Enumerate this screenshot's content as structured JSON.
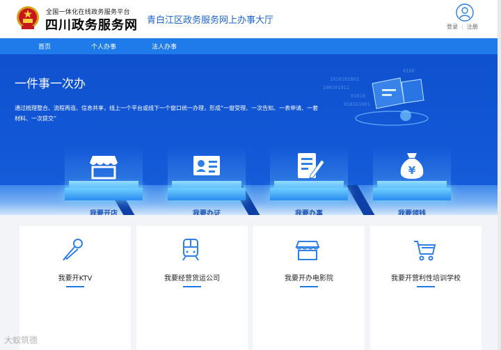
{
  "header": {
    "portal_subtitle": "全国一体化在线政务服务平台",
    "portal_name": "四川政务服务网",
    "hall_title": "青白江区政务服务网上办事大厅",
    "login_label": "登录",
    "register_label": "注册"
  },
  "nav": {
    "items": [
      {
        "label": "首页"
      },
      {
        "label": "个人办事"
      },
      {
        "label": "法人办事"
      }
    ]
  },
  "banner": {
    "title": "一件事一次办",
    "description": "通过梳理整合、流程再造、信息共享，线上一个平台或线下一个窗口统一办理，形成“一窗受理、一次告知、一表申请、一套材料、一次提交”",
    "binary_text": [
      "0100",
      "1010101001",
      "100101011",
      "01010",
      "010101001"
    ],
    "platforms": [
      {
        "label": "我要开店",
        "icon": "shop-icon"
      },
      {
        "label": "我要办证",
        "icon": "id-card-icon"
      },
      {
        "label": "我要办事",
        "icon": "document-edit-icon"
      },
      {
        "label": "我要领钱",
        "icon": "money-bag-icon"
      }
    ]
  },
  "cards": [
    {
      "label": "我要开KTV",
      "icon": "microphone-icon"
    },
    {
      "label": "我要经营货运公司",
      "icon": "train-icon"
    },
    {
      "label": "我要开办电影院",
      "icon": "shop-icon"
    },
    {
      "label": "我要开营利性培训学校",
      "icon": "cart-icon"
    }
  ],
  "watermark": "大蚁筑德",
  "colors": {
    "accent": "#1f7bea",
    "banner": "#1257d6",
    "platform_label": "#174fb3"
  }
}
